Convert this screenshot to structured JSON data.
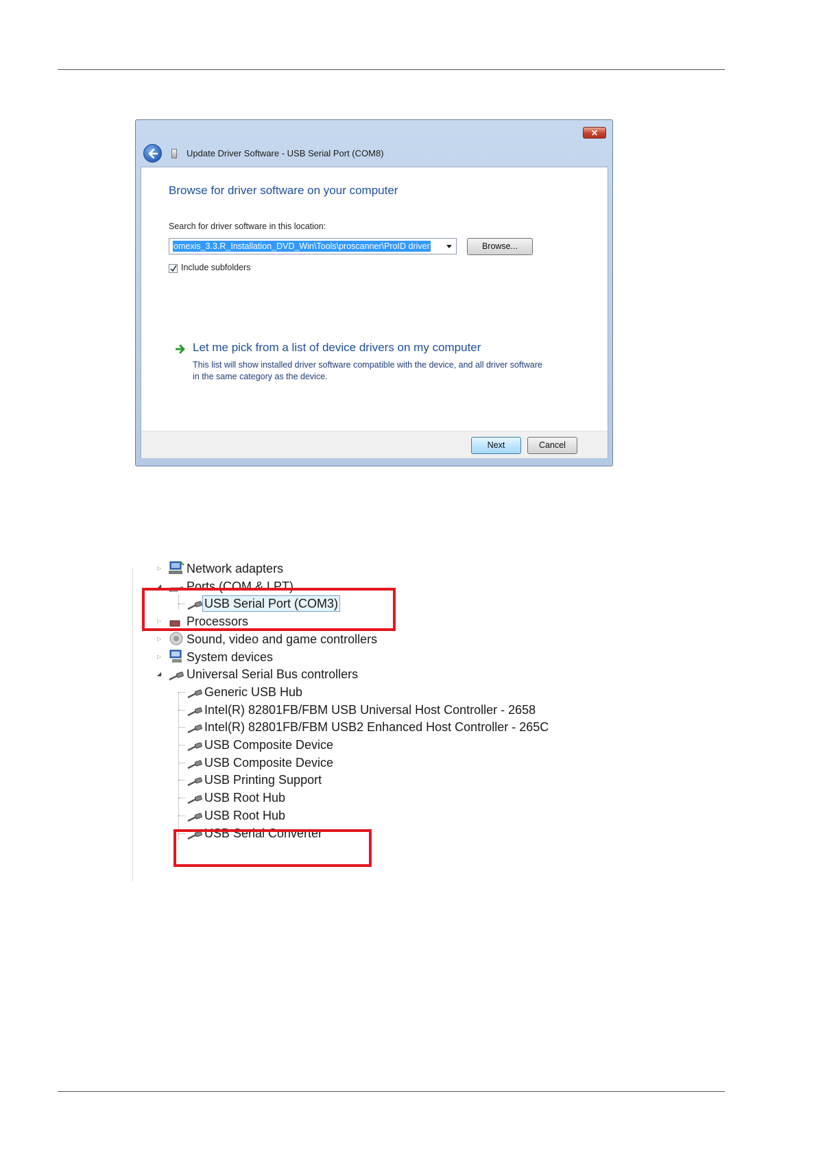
{
  "dialog": {
    "title": "Update Driver Software - USB Serial Port (COM8)",
    "close_label": "✕",
    "heading": "Browse for driver software on your computer",
    "search_label": "Search for driver software in this location:",
    "path_value": "omexis_3.3.R_Installation_DVD_Win\\Tools\\proscanner\\ProID driver",
    "browse_label": "Browse...",
    "include_subfolders_label": "Include subfolders",
    "include_subfolders_checked": true,
    "pick_link": "Let me pick from a list of device drivers on my computer",
    "pick_description": "This list will show installed driver software compatible with the device, and all driver software in the same category as the device.",
    "next_label": "Next",
    "cancel_label": "Cancel"
  },
  "tree": {
    "items": [
      {
        "label": "Network adapters",
        "icon": "network-adapter-icon",
        "expander": "collapsed"
      },
      {
        "label": "Ports (COM & LPT)",
        "icon": "port-icon",
        "expander": "expanded"
      },
      {
        "label": "USB Serial Port (COM3)",
        "icon": "usb-plug-icon",
        "selected": true
      },
      {
        "label": "Processors",
        "icon": "processor-icon",
        "expander": "collapsed"
      },
      {
        "label": "Sound, video and game controllers",
        "icon": "speaker-icon",
        "expander": "collapsed"
      },
      {
        "label": "System devices",
        "icon": "computer-icon",
        "expander": "collapsed"
      },
      {
        "label": "Universal Serial Bus controllers",
        "icon": "usb-plug-icon",
        "expander": "expanded"
      },
      {
        "label": "Generic USB Hub",
        "icon": "usb-plug-icon"
      },
      {
        "label": "Intel(R) 82801FB/FBM USB Universal Host Controller - 2658",
        "icon": "usb-plug-icon"
      },
      {
        "label": "Intel(R) 82801FB/FBM USB2 Enhanced Host Controller - 265C",
        "icon": "usb-plug-icon"
      },
      {
        "label": "USB Composite Device",
        "icon": "usb-plug-icon"
      },
      {
        "label": "USB Composite Device",
        "icon": "usb-plug-icon"
      },
      {
        "label": "USB Printing Support",
        "icon": "usb-plug-icon"
      },
      {
        "label": "USB Root Hub",
        "icon": "usb-plug-icon"
      },
      {
        "label": "USB Root Hub",
        "icon": "usb-plug-icon"
      },
      {
        "label": "USB Serial Converter",
        "icon": "usb-plug-icon"
      }
    ]
  },
  "highlight_color": "#e3171f"
}
